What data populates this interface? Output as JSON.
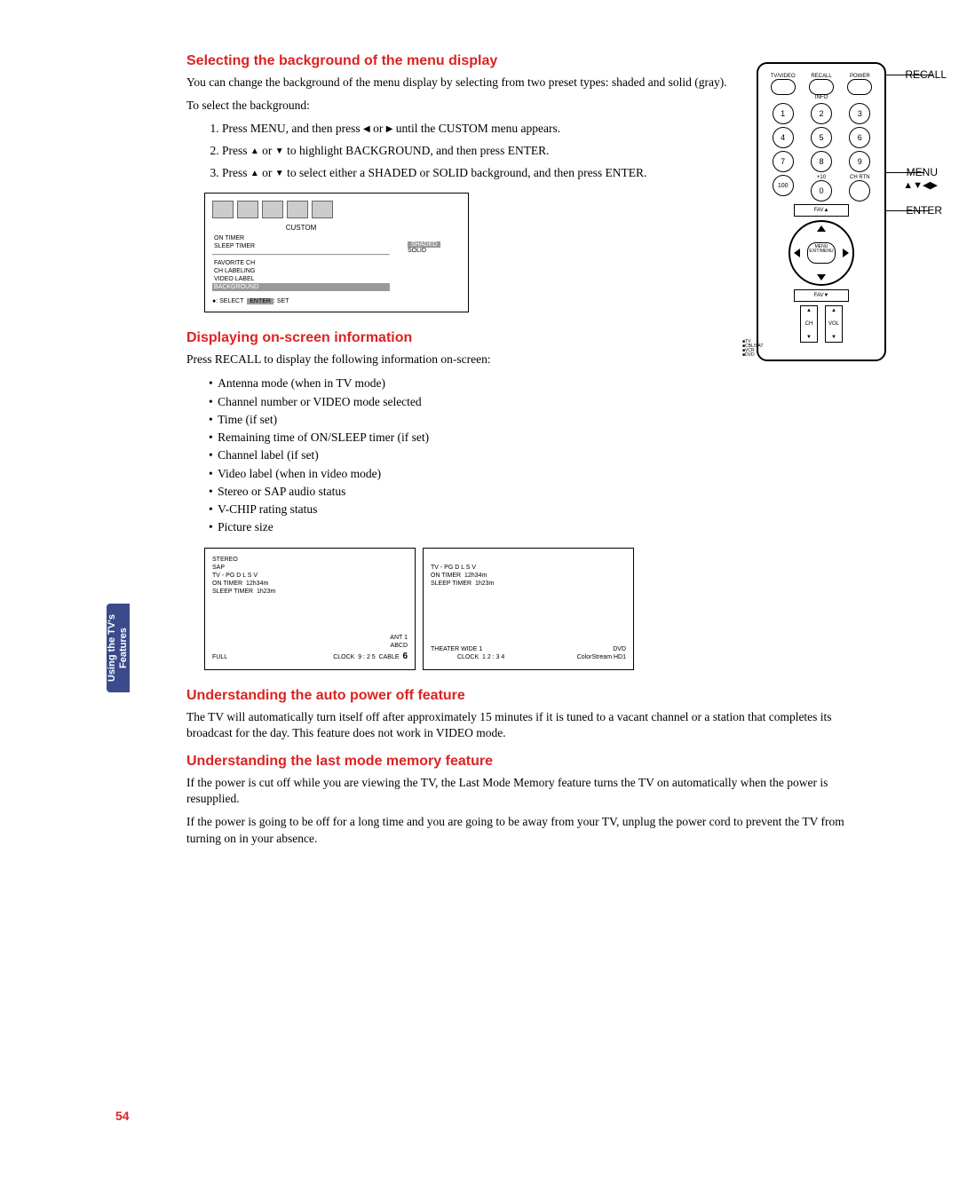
{
  "sidebar": {
    "label": "Using the TV's\nFeatures"
  },
  "s1": {
    "title": "Selecting the background of the menu display",
    "p1": "You can change the background of the menu display by selecting from two preset types: shaded and solid (gray).",
    "p2": "To select the background:",
    "li1a": "Press MENU, and then press ",
    "li1b": " or ",
    "li1c": " until the CUSTOM menu appears.",
    "li2a": "Press ",
    "li2b": " or ",
    "li2c": " to highlight BACKGROUND, and then press ENTER.",
    "li3a": "Press ",
    "li3b": " or ",
    "li3c": " to select either a SHADED or SOLID background, and then press ENTER."
  },
  "menu": {
    "title": "CUSTOM",
    "items": [
      "ON TIMER",
      "SLEEP TIMER",
      "FAVORITE CH",
      "CH LABELING",
      "VIDEO LABEL",
      "BACKGROUND"
    ],
    "values": [
      "SHADED",
      "SOLID"
    ],
    "footer_select": ": SELECT",
    "footer_enter": "ENTER",
    "footer_set": ": SET"
  },
  "remote": {
    "top_labels": [
      "TV/VIDEO",
      "RECALL",
      "POWER"
    ],
    "info": "INFO",
    "keys": [
      "1",
      "2",
      "3",
      "4",
      "5",
      "6",
      "7",
      "8",
      "9",
      "100",
      "0",
      "CH RTN"
    ],
    "plus10": "+10",
    "fav_up": "FAV▲",
    "fav_down": "FAV▼",
    "menu_btn": "MENU",
    "exit_btn": "EXIT/MENU",
    "ch": "CH",
    "vol": "VOL",
    "side": [
      "TV",
      "CBL/SAT",
      "VCR",
      "DVD"
    ],
    "callouts": {
      "recall": "RECALL",
      "menu": "MENU",
      "arrows": "▲▼◀▶",
      "enter": "ENTER"
    }
  },
  "s2": {
    "title": "Displaying on-screen information",
    "p1": "Press RECALL to display the following information on-screen:",
    "items": [
      "Antenna mode (when in TV mode)",
      "Channel number or VIDEO mode selected",
      "Time (if set)",
      "Remaining time of ON/SLEEP timer (if set)",
      "Channel label (if set)",
      "Video label (when in video mode)",
      "Stereo or SAP audio status",
      "V-CHIP rating status",
      "Picture size"
    ]
  },
  "osd1": {
    "stereo": "STEREO",
    "sap": "SAP",
    "rating": "TV - PG D L S V",
    "on": "ON TIMER",
    "ont": "12h34m",
    "sl": "SLEEP TIMER",
    "slt": "1h23m",
    "full": "FULL",
    "ant": "ANT 1",
    "abcd": "ABCD",
    "clock": "CLOCK",
    "time": "9 : 2 5",
    "cable": "CABLE",
    "ch": "6"
  },
  "osd2": {
    "rating": "TV - PG D L S V",
    "on": "ON TIMER",
    "ont": "12h34m",
    "sl": "SLEEP TIMER",
    "slt": "1h23m",
    "tw": "THEATER WIDE 1",
    "clock": "CLOCK",
    "time": "1 2 : 3 4",
    "cs": "ColorStream",
    "dvd": "DVD",
    "hd": "HD1"
  },
  "s3": {
    "title": "Understanding the auto power off feature",
    "p1": "The TV will automatically turn itself off after approximately 15 minutes if it is tuned to a vacant channel or a station that completes its broadcast for the day. This feature does not work in VIDEO mode."
  },
  "s4": {
    "title": "Understanding the last mode memory feature",
    "p1": "If the power is cut off while you are viewing the TV, the Last Mode Memory feature turns the TV on automatically when the power is resupplied.",
    "p2": "If the power is going to be off for a long time and you are going to be away from your TV, unplug the power cord to prevent the TV from turning on in your absence."
  },
  "page_number": "54"
}
